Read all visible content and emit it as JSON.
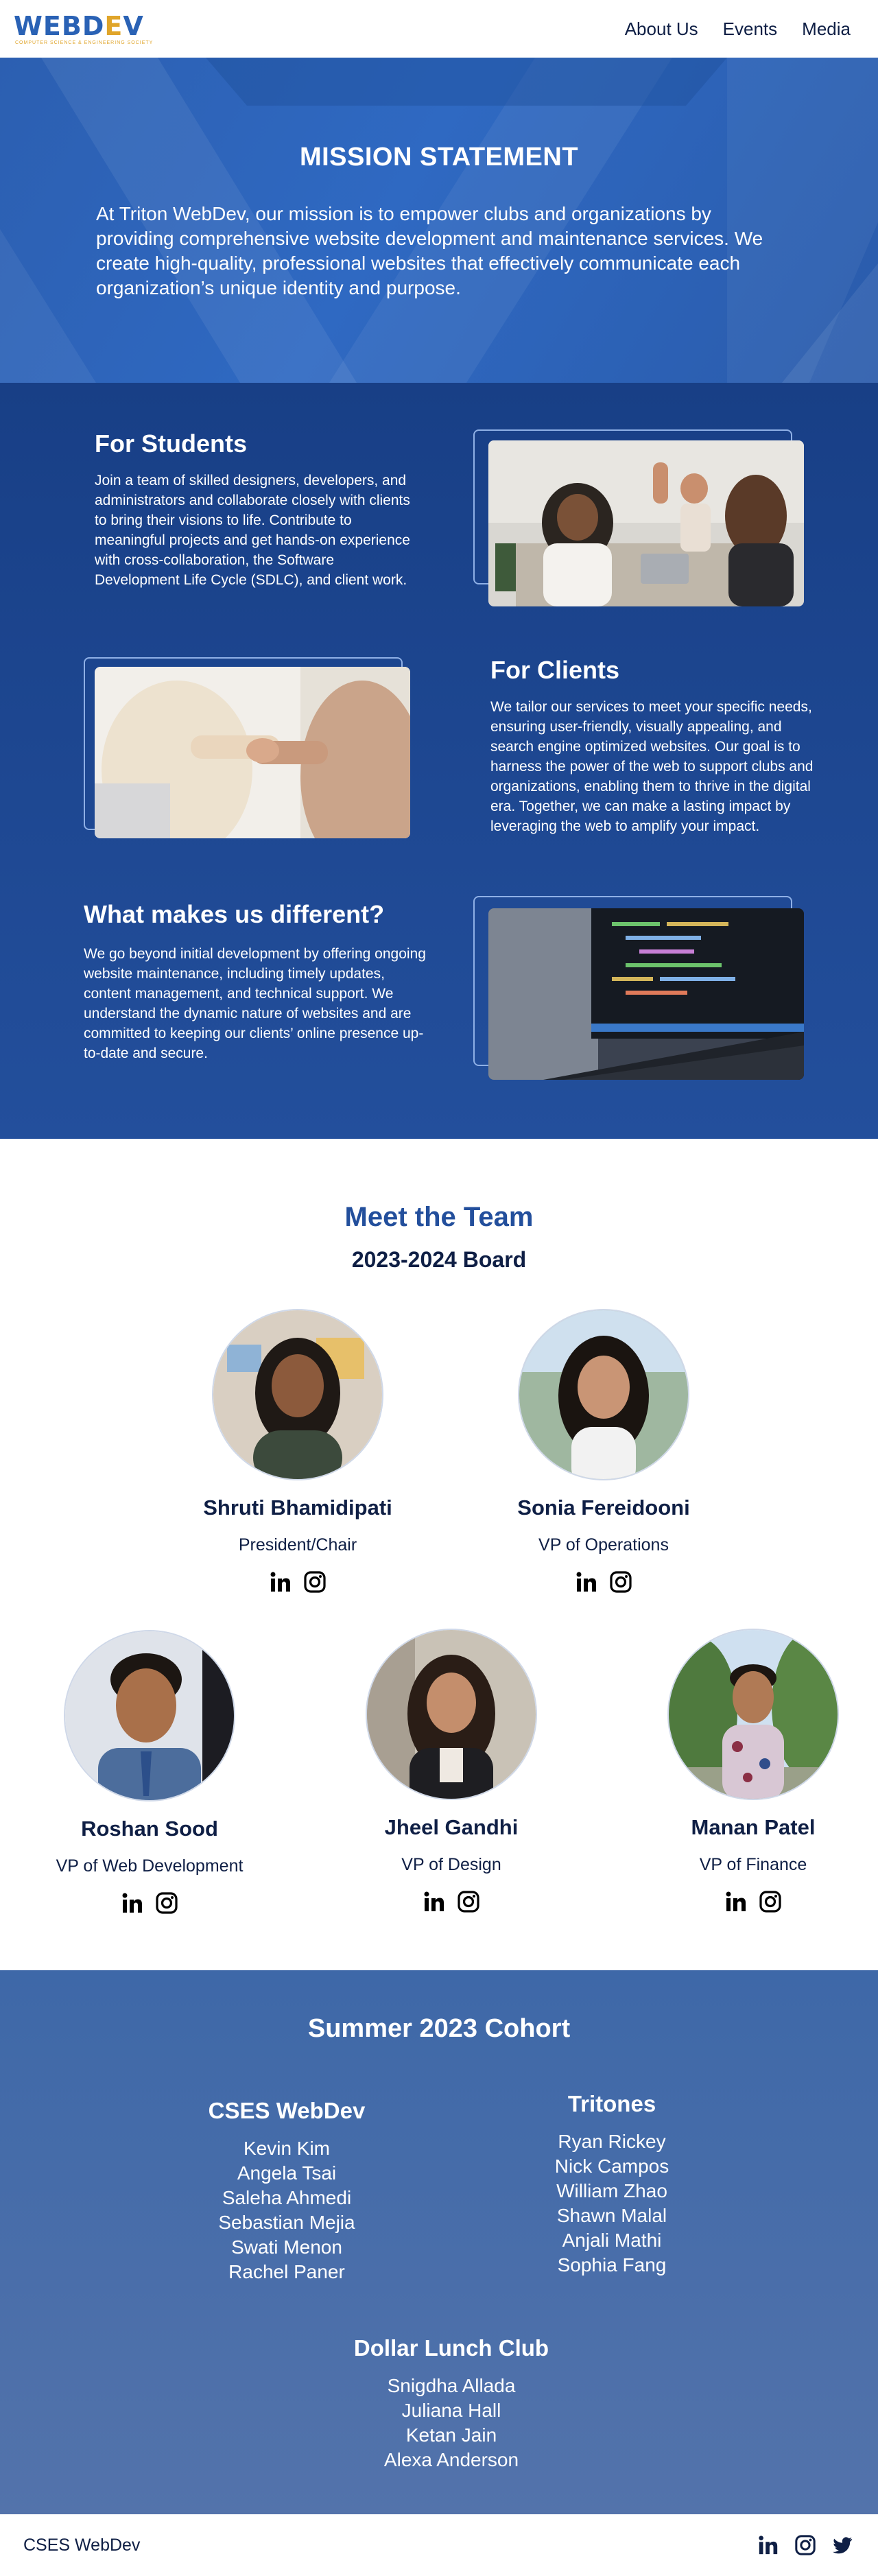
{
  "nav": {
    "logo": "WEBDEV",
    "logo_left": "WEBD",
    "logo_accent": "E",
    "logo_right": "V",
    "tagline": "COMPUTER SCIENCE & ENGINEERING SOCIETY",
    "links": [
      "About Us",
      "Events",
      "Media"
    ]
  },
  "mission": {
    "title": "MISSION STATEMENT",
    "text": "At Triton WebDev, our mission is to empower clubs and organizations by providing comprehensive website development and maintenance services. We create high-quality, professional websites that effectively communicate each organization’s unique identity and purpose."
  },
  "features": [
    {
      "title": "For Students",
      "text": "Join a team of skilled designers, developers, and administrators and collaborate closely with clients to bring their visions to life. Contribute to meaningful projects and get hands-on experience with cross-collaboration, the Software Development Life Cycle (SDLC), and client work.",
      "image_icon": "team-high-five-photo"
    },
    {
      "title": "For Clients",
      "text": "We tailor our services to meet your specific needs, ensuring user-friendly, visually appealing, and search engine optimized websites. Our goal is to harness the power of the web to support clubs and organizations, enabling them to thrive in the digital era. Together, we can make a lasting impact by leveraging the web to amplify your  impact.",
      "image_icon": "handshake-photo"
    },
    {
      "title": "What makes us different?",
      "text": "We go beyond initial development by offering ongoing website maintenance, including timely updates, content management, and technical support. We understand the dynamic nature of websites and are committed to keeping our clients’ online presence up-to-date and secure.",
      "image_icon": "laptop-code-photo"
    }
  ],
  "team": {
    "title": "Meet the Team",
    "board_title": "2023-2024 Board",
    "members": [
      {
        "name": "Shruti Bhamidipati",
        "role": "President/Chair"
      },
      {
        "name": "Sonia Fereidooni",
        "role": "VP of Operations"
      },
      {
        "name": "Roshan Sood",
        "role": "VP of Web Development"
      },
      {
        "name": "Jheel Gandhi",
        "role": "VP of Design"
      },
      {
        "name": "Manan Patel",
        "role": "VP of Finance"
      }
    ],
    "social_icons": [
      "linkedin-icon",
      "instagram-icon"
    ]
  },
  "cohort": {
    "title": "Summer 2023 Cohort",
    "groups": [
      {
        "title": "CSES WebDev",
        "members": [
          "Kevin Kim",
          "Angela Tsai",
          "Saleha Ahmedi",
          "Sebastian Mejia",
          "Swati Menon",
          "Rachel Paner"
        ]
      },
      {
        "title": "Tritones",
        "members": [
          "Ryan Rickey",
          "Nick Campos",
          "William Zhao",
          "Shawn Malal",
          "Anjali Mathi",
          "Sophia Fang"
        ]
      },
      {
        "title": "Dollar Lunch Club",
        "members": [
          "Snigdha Allada",
          "Juliana Hall",
          "Ketan Jain",
          "Alexa Anderson"
        ]
      }
    ]
  },
  "footer": {
    "brand": "CSES WebDev",
    "icons": [
      "linkedin-icon",
      "instagram-icon",
      "twitter-icon"
    ]
  },
  "colors": {
    "brand_blue": "#2a62b5",
    "brand_gold": "#e0a52a",
    "navy_text": "#0f1f45",
    "section_blue": "#234f9c"
  }
}
